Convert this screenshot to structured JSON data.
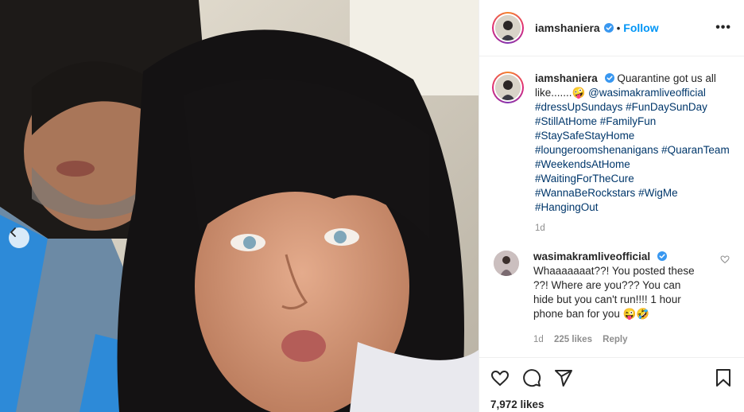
{
  "post": {
    "username": "iamshaniera",
    "follow_label": "Follow",
    "dot": "•",
    "more_label": "•••",
    "caption_text": "Quarantine got us all like.......",
    "caption_emoji": "🤪",
    "caption_mention": "@wasimakramliveofficial",
    "hashtags": [
      "#dressUpSundays",
      "#FunDaySunDay",
      "#StillAtHome",
      "#FamilyFun",
      "#StaySafeStayHome",
      "#loungeroomshenanigans",
      "#QuaranTeam",
      "#WeekendsAtHome",
      "#WaitingForTheCure",
      "#WannaBeRockstars",
      "#WigMe",
      "#HangingOut"
    ],
    "time": "1d",
    "likes": "7,972 likes"
  },
  "comment": {
    "username": "wasimakramliveofficial",
    "text": "Whaaaaaaat??! You posted these ??! Where are you??? You can hide but you can't run!!!! 1 hour phone ban for you",
    "emoji": "😜🤣",
    "time": "1d",
    "likes": "225 likes",
    "reply_label": "Reply"
  },
  "icons": {
    "verified": "verified-badge-icon",
    "prev": "chevron-left-icon",
    "like": "heart-icon",
    "comment": "comment-icon",
    "share": "share-icon",
    "save": "bookmark-icon",
    "comment_like": "heart-small-icon"
  },
  "colors": {
    "link": "#00376b",
    "accent": "#0095f6",
    "muted": "#8e8e8e",
    "verified": "#3897f0"
  }
}
